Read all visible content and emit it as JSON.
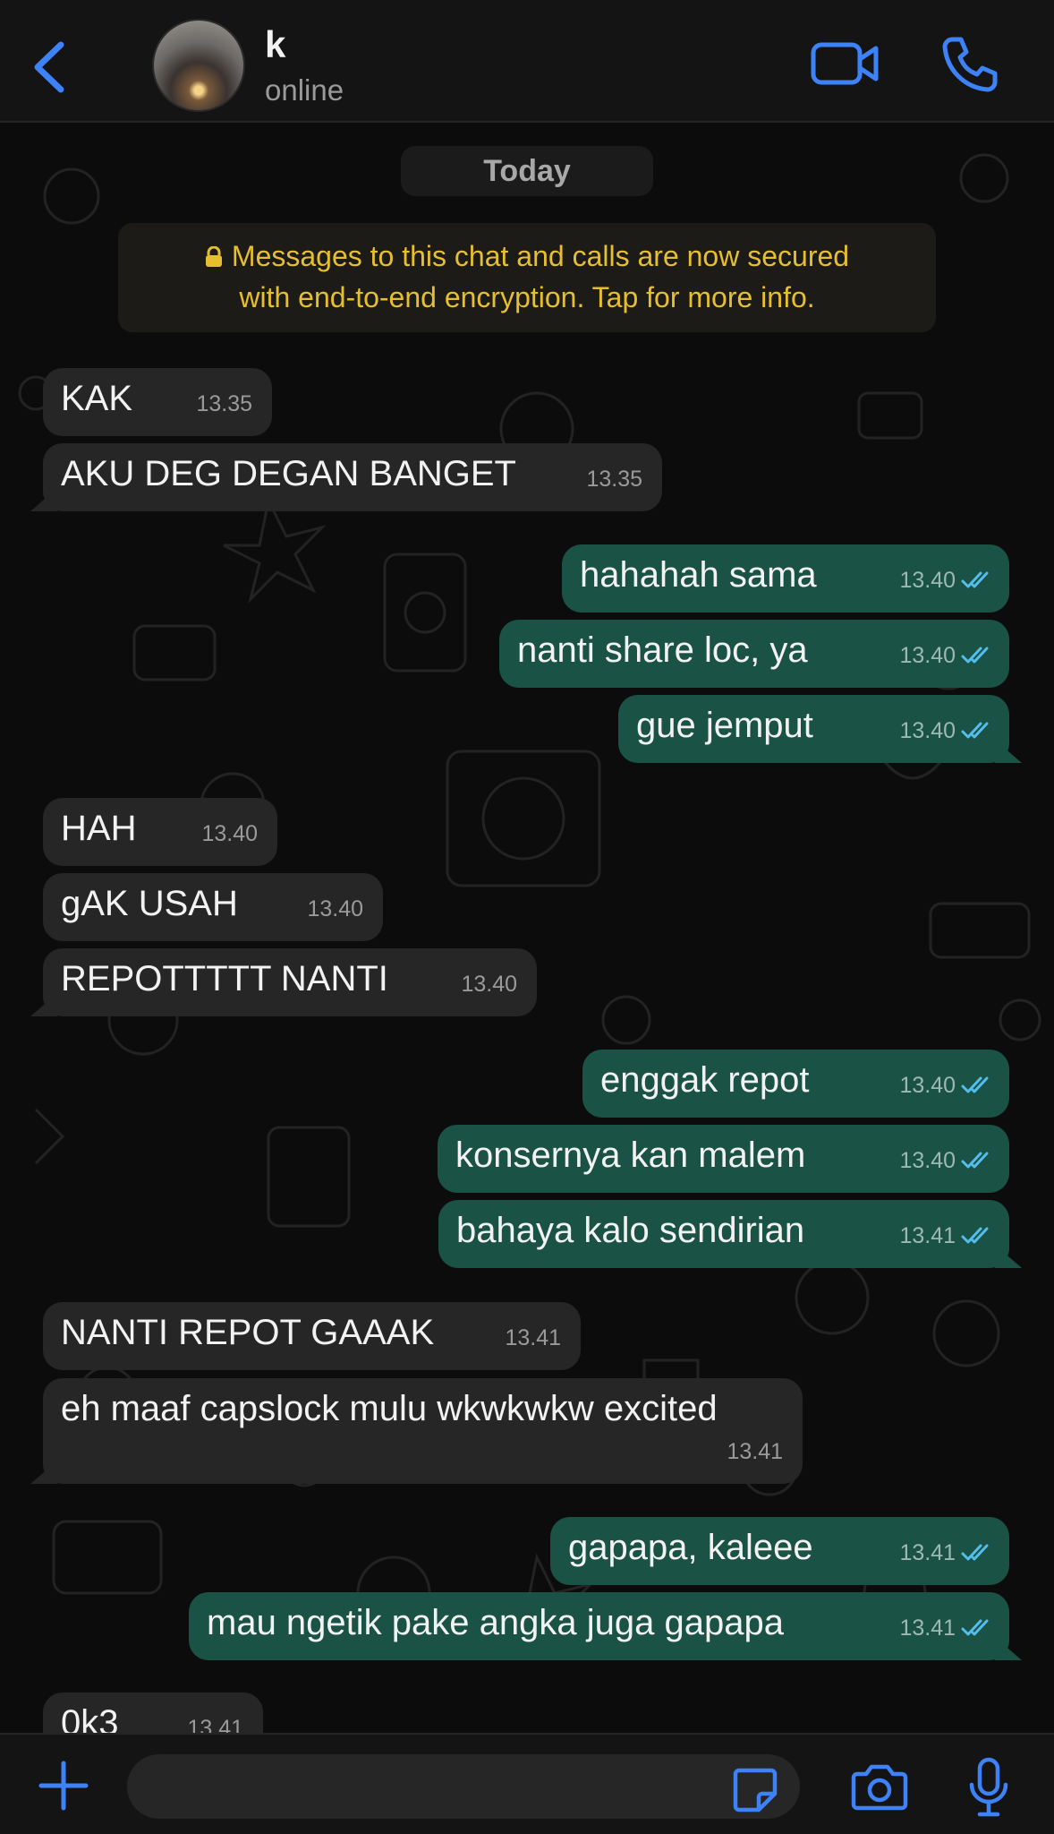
{
  "header": {
    "contact_name": "k",
    "status": "online",
    "icons": {
      "back": "chevron-left-icon",
      "video": "video-camera-icon",
      "call": "phone-icon",
      "avatar": "contact-avatar"
    }
  },
  "chat": {
    "date_label": "Today",
    "encryption_notice_line1": "Messages to this chat and calls are now secured",
    "encryption_notice_line2": "with end-to-end encryption. Tap for more info.",
    "messages": [
      {
        "dir": "in",
        "text": "KAK",
        "time": "13.35"
      },
      {
        "dir": "in",
        "text": "AKU DEG DEGAN BANGET",
        "time": "13.35"
      },
      {
        "dir": "out",
        "text": "hahahah sama",
        "time": "13.40",
        "status": "read"
      },
      {
        "dir": "out",
        "text": "nanti share loc, ya",
        "time": "13.40",
        "status": "read"
      },
      {
        "dir": "out",
        "text": "gue jemput",
        "time": "13.40",
        "status": "read"
      },
      {
        "dir": "in",
        "text": "HAH",
        "time": "13.40"
      },
      {
        "dir": "in",
        "text": "gAK USAH",
        "time": "13.40"
      },
      {
        "dir": "in",
        "text": "REPOTTTTT NANTI",
        "time": "13.40"
      },
      {
        "dir": "out",
        "text": "enggak repot",
        "time": "13.40",
        "status": "read"
      },
      {
        "dir": "out",
        "text": "konsernya kan malem",
        "time": "13.40",
        "status": "read"
      },
      {
        "dir": "out",
        "text": "bahaya kalo sendirian",
        "time": "13.41",
        "status": "read"
      },
      {
        "dir": "in",
        "text": "NANTI REPOT GAAAK",
        "time": "13.41"
      },
      {
        "dir": "in",
        "text": "eh maaf capslock mulu wkwkwkw excited",
        "time": "13.41"
      },
      {
        "dir": "out",
        "text": "gapapa, kaleee",
        "time": "13.41",
        "status": "read"
      },
      {
        "dir": "out",
        "text": "mau ngetik pake angka juga gapapa",
        "time": "13.41",
        "status": "read"
      },
      {
        "dir": "in",
        "text": "0k3",
        "time": "13.41"
      }
    ]
  },
  "composer": {
    "input_value": "",
    "icons": {
      "plus": "plus-icon",
      "sticker": "sticker-icon",
      "camera": "camera-icon",
      "mic": "microphone-icon"
    }
  },
  "colors": {
    "accent": "#3e82f7",
    "outgoing_bubble": "#1a5245",
    "incoming_bubble": "#262626",
    "encryption_text": "#e6bf2e",
    "read_tick": "#53bdeb"
  }
}
